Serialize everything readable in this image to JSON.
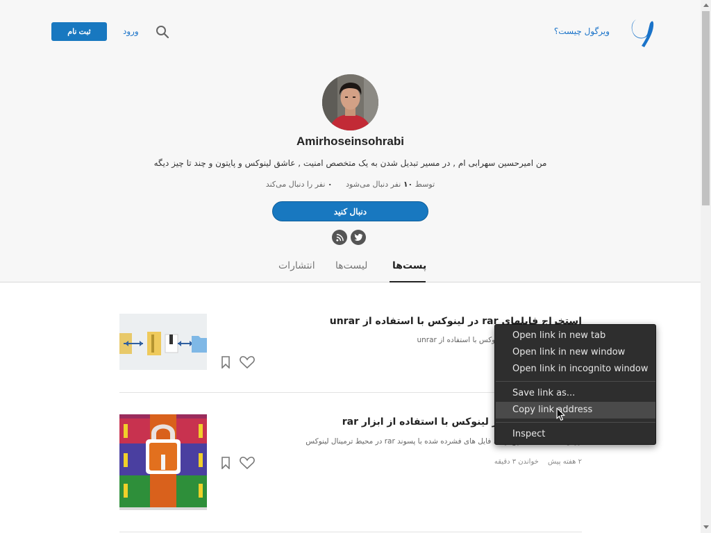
{
  "header": {
    "what_is_link": "ویرگول چیست؟",
    "login_label": "ورود",
    "signup_label": "ثبت نام",
    "brand_color": "#1878c0"
  },
  "profile": {
    "name": "Amirhoseinsohrabi",
    "bio": "من امیرحسین سهرابی ام , در مسیر تبدیل شدن به یک متخصص امنیت , عاشق لینوکس و پایتون و چند تا چیز دیگه",
    "followers_prefix": "توسط",
    "followers_count": "۱۰",
    "followers_suffix": "نفر دنبال می‌شود",
    "following_count": "۰",
    "following_suffix": "نفر را دنبال می‌کند",
    "follow_label": "دنبال کنید",
    "social_icons": [
      "twitter-icon",
      "rss-icon"
    ]
  },
  "tabs": [
    {
      "label": "پست‌ها",
      "active": true
    },
    {
      "label": "لیست‌ها",
      "active": false
    },
    {
      "label": "انتشارات",
      "active": false
    }
  ],
  "posts": [
    {
      "title": "استخراج فایلهای rar در لینوکس با استفاده از unrar",
      "summary": "استخراج فایل های rar در لینوکس با استفاده از unrar",
      "time_ago": "",
      "read_time": ""
    },
    {
      "title": "ساخت فایل rar در لینوکس با استفاده از ابزار rar",
      "summary": "روش ساخت , استخراج و .... فایل های فشرده شده با پسوند rar در محیط ترمینال لینوکس",
      "time_ago": "۲ هفته پیش",
      "read_time": "خواندن ۳ دقیقه"
    }
  ],
  "context_menu": {
    "items": [
      {
        "label": "Open link in new tab"
      },
      {
        "label": "Open link in new window"
      },
      {
        "label": "Open link in incognito window"
      },
      {
        "label": "Save link as..."
      },
      {
        "label": "Copy link address",
        "highlighted": true
      },
      {
        "label": "Inspect"
      }
    ]
  }
}
